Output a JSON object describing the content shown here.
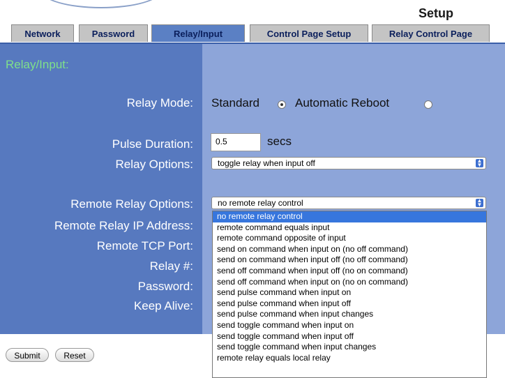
{
  "page_title": "Setup",
  "tabs": [
    {
      "label": "Network"
    },
    {
      "label": "Password"
    },
    {
      "label": "Relay/Input"
    },
    {
      "label": "Control Page Setup"
    },
    {
      "label": "Relay Control Page"
    }
  ],
  "active_tab": "Relay/Input",
  "section_title": "Relay/Input:",
  "labels": {
    "relay_mode": "Relay Mode:",
    "pulse_duration": "Pulse Duration:",
    "relay_options": "Relay Options:",
    "remote_relay_options": "Remote Relay Options:",
    "remote_relay_ip": "Remote Relay IP Address:",
    "remote_tcp_port": "Remote TCP Port:",
    "relay_number": "Relay #:",
    "password": "Password:",
    "keep_alive": "Keep Alive:"
  },
  "relay_mode": {
    "standard_label": "Standard",
    "standard_checked": true,
    "auto_reboot_label": "Automatic Reboot",
    "auto_reboot_checked": false
  },
  "pulse_duration": {
    "value": "0.5",
    "unit": "secs"
  },
  "relay_options": {
    "selected": "toggle relay when input off"
  },
  "remote_relay_options": {
    "selected": "no remote relay control",
    "options": [
      "no remote relay control",
      "remote command equals input",
      "remote command opposite of input",
      "send on command when input on (no off command)",
      "send on command when input off (no off command)",
      "send off command when input off (no on command)",
      "send off command when input on (no on command)",
      "send pulse command when input on",
      "send pulse command when input off",
      "send pulse command when input changes",
      "send toggle command when input on",
      "send toggle command when input off",
      "send toggle command when input changes",
      "remote relay equals local relay"
    ]
  },
  "buttons": {
    "submit": "Submit",
    "reset": "Reset"
  },
  "colors": {
    "panel_left": "#5779bf",
    "panel_right": "#8da5d9",
    "section_title": "#7fe08a",
    "tab_active": "#5b80c4",
    "tab_inactive": "#c4c4c4",
    "highlight": "#3776dd"
  }
}
